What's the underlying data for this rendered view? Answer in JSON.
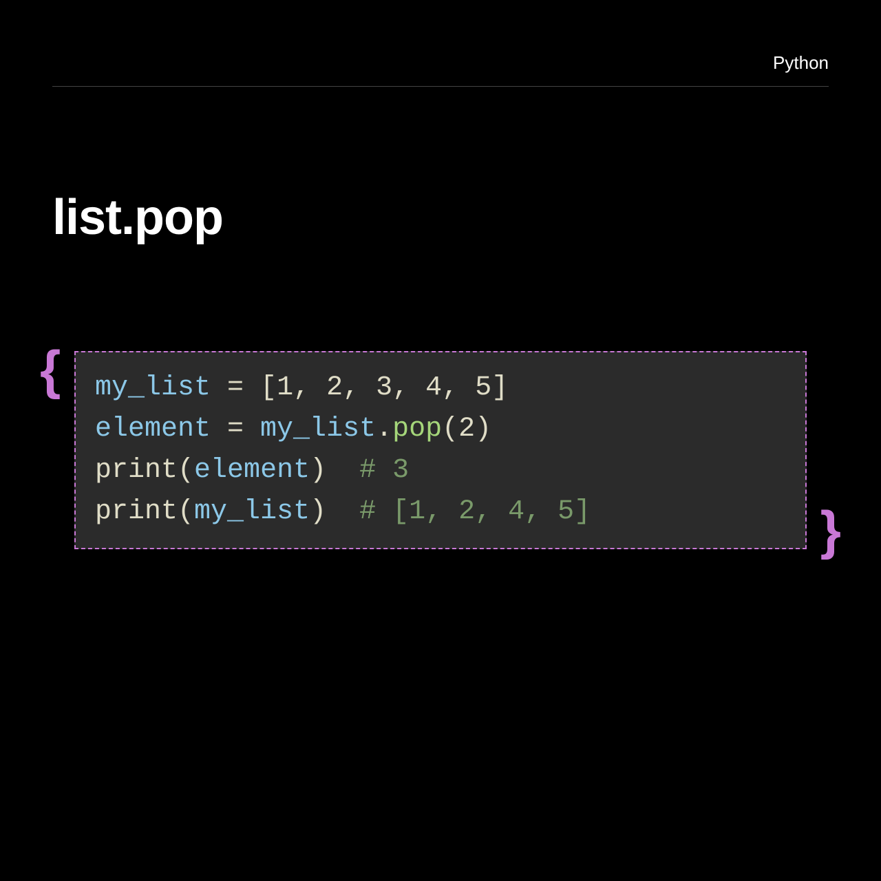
{
  "header": {
    "language_label": "Python"
  },
  "title": "list.pop",
  "decor": {
    "brace_left": "{",
    "brace_right": "}"
  },
  "code": {
    "line1": {
      "var": "my_list",
      "eq": " = ",
      "open": "[",
      "n1": "1",
      "c1": ", ",
      "n2": "2",
      "c2": ", ",
      "n3": "3",
      "c3": ", ",
      "n4": "4",
      "c4": ", ",
      "n5": "5",
      "close": "]"
    },
    "line2": {
      "var": "element",
      "eq": " = ",
      "obj": "my_list",
      "dot": ".",
      "method": "pop",
      "open": "(",
      "arg": "2",
      "close": ")"
    },
    "line3": {
      "fn": "print",
      "open": "(",
      "arg": "element",
      "close": ")",
      "space": "  ",
      "comment": "# 3"
    },
    "line4": {
      "fn": "print",
      "open": "(",
      "arg": "my_list",
      "close": ")",
      "space": "  ",
      "comment": "# [1, 2, 4, 5]"
    }
  }
}
